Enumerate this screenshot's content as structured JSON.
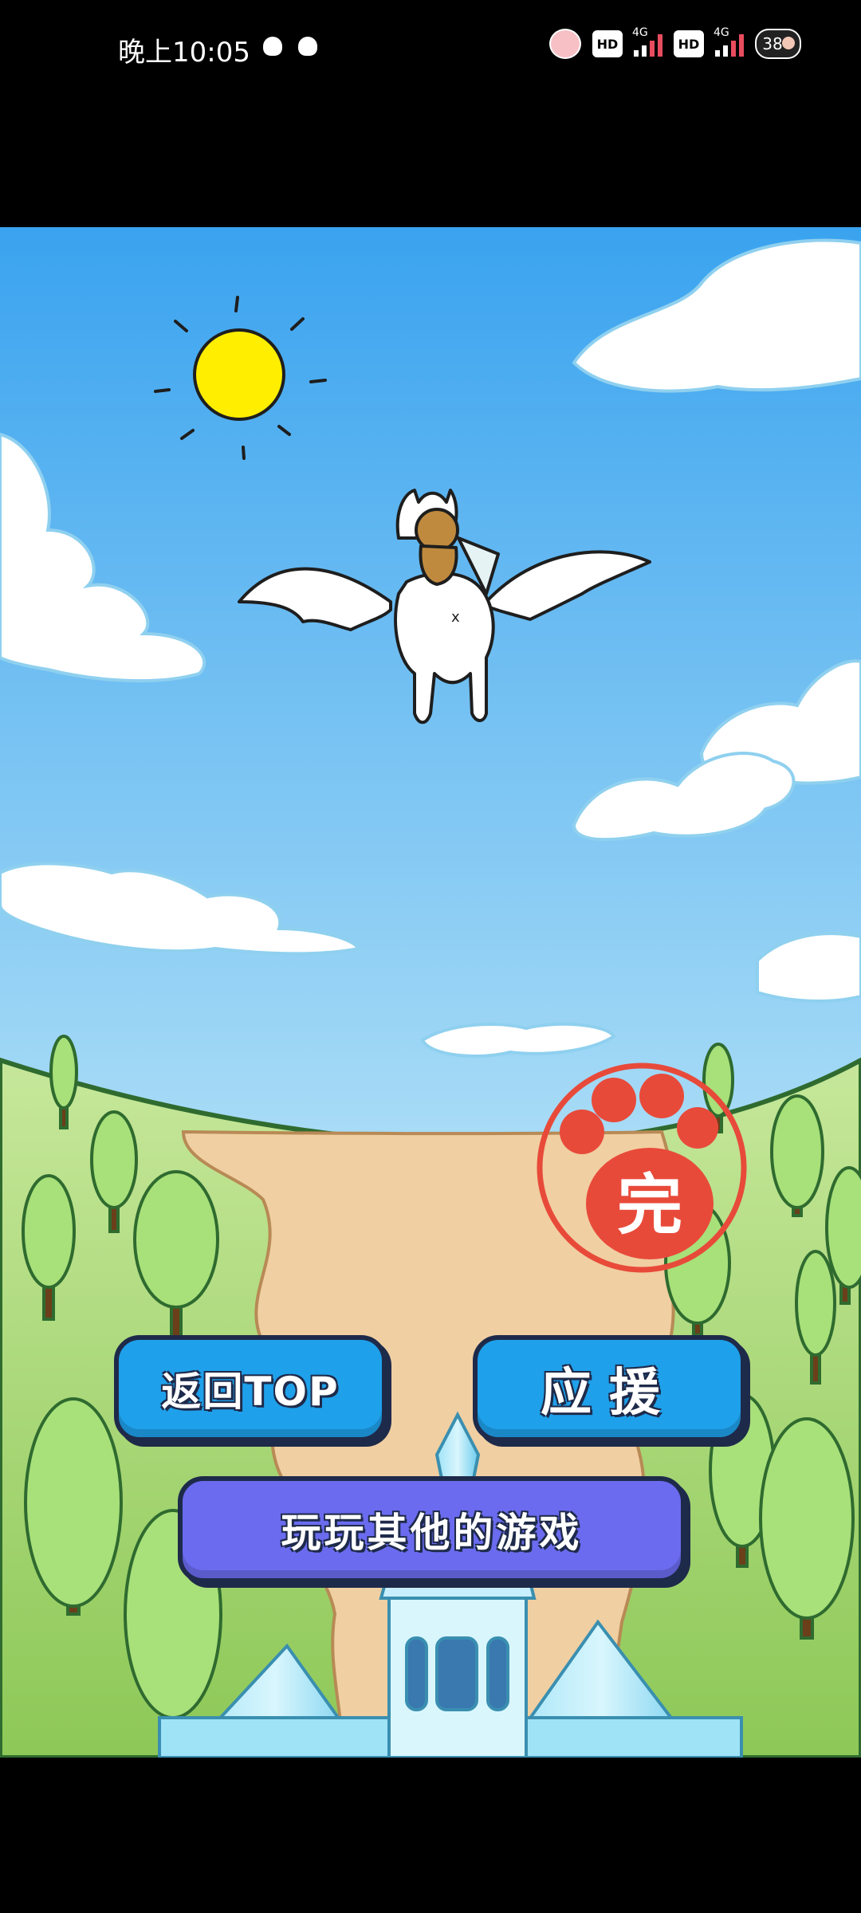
{
  "status_bar": {
    "time": "晚上10:05",
    "hd_1": "HD",
    "net_1": "4G",
    "hd_2": "HD",
    "net_2": "4G",
    "battery": "38"
  },
  "game": {
    "buttons": {
      "back_to_top": "返回TOP",
      "cheer": "应援",
      "play_other_games": "玩玩其他的游戏"
    },
    "stamp": {
      "label": "完",
      "color": "#e84a3a"
    },
    "colors": {
      "sky_top": "#3aa3ef",
      "sky_bottom": "#d9f1fb",
      "grass": "#a6d66a",
      "path": "#f0cfa2",
      "button_blue": "#1fa0ea",
      "button_purple": "#6b6bef",
      "sun": "#ffee00"
    }
  }
}
